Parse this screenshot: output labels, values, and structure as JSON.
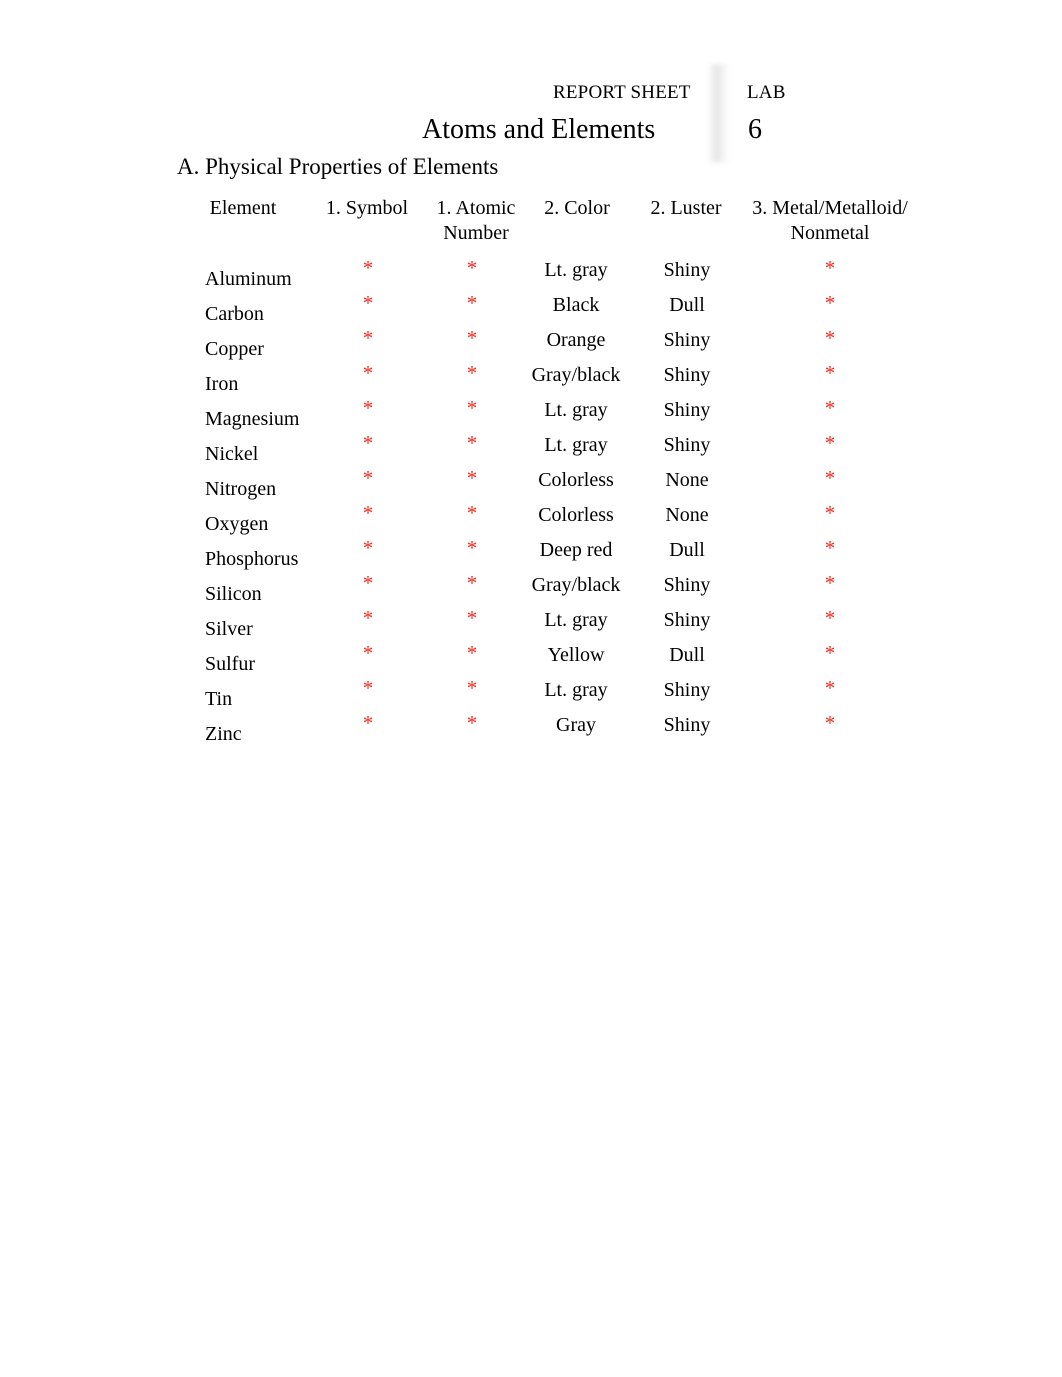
{
  "header": {
    "report_sheet_label": "REPORT SHEET",
    "lab_label": "LAB",
    "title": "Atoms and Elements",
    "lab_number": "6"
  },
  "section": {
    "heading": "A. Physical Properties of Elements"
  },
  "table": {
    "columns": [
      "Element",
      "1. Symbol",
      "1. Atomic Number",
      "2. Color",
      "2. Luster",
      "3. Metal/Metalloid/ Nonmetal"
    ],
    "blank_marker": "*",
    "marker_color": "#f22d20",
    "rows": [
      {
        "element": "Aluminum",
        "symbol": "*",
        "atomic_number": "*",
        "color": "Lt. gray",
        "luster": "Shiny",
        "classification": "*"
      },
      {
        "element": "Carbon",
        "symbol": "*",
        "atomic_number": "*",
        "color": "Black",
        "luster": "Dull",
        "classification": "*"
      },
      {
        "element": "Copper",
        "symbol": "*",
        "atomic_number": "*",
        "color": "Orange",
        "luster": "Shiny",
        "classification": "*"
      },
      {
        "element": "Iron",
        "symbol": "*",
        "atomic_number": "*",
        "color": "Gray/black",
        "luster": "Shiny",
        "classification": "*"
      },
      {
        "element": "Magnesium",
        "symbol": "*",
        "atomic_number": "*",
        "color": "Lt. gray",
        "luster": "Shiny",
        "classification": "*"
      },
      {
        "element": "Nickel",
        "symbol": "*",
        "atomic_number": "*",
        "color": "Lt. gray",
        "luster": "Shiny",
        "classification": "*"
      },
      {
        "element": "Nitrogen",
        "symbol": "*",
        "atomic_number": "*",
        "color": "Colorless",
        "luster": "None",
        "classification": "*"
      },
      {
        "element": "Oxygen",
        "symbol": "*",
        "atomic_number": "*",
        "color": "Colorless",
        "luster": "None",
        "classification": "*"
      },
      {
        "element": "Phosphorus",
        "symbol": "*",
        "atomic_number": "*",
        "color": "Deep red",
        "luster": "Dull",
        "classification": "*"
      },
      {
        "element": "Silicon",
        "symbol": "*",
        "atomic_number": "*",
        "color": "Gray/black",
        "luster": "Shiny",
        "classification": "*"
      },
      {
        "element": "Silver",
        "symbol": "*",
        "atomic_number": "*",
        "color": "Lt. gray",
        "luster": "Shiny",
        "classification": "*"
      },
      {
        "element": "Sulfur",
        "symbol": "*",
        "atomic_number": "*",
        "color": "Yellow",
        "luster": "Dull",
        "classification": "*"
      },
      {
        "element": "Tin",
        "symbol": "*",
        "atomic_number": "*",
        "color": "Lt. gray",
        "luster": "Shiny",
        "classification": "*"
      },
      {
        "element": "Zinc",
        "symbol": "*",
        "atomic_number": "*",
        "color": "Gray",
        "luster": "Shiny",
        "classification": "*"
      }
    ]
  }
}
